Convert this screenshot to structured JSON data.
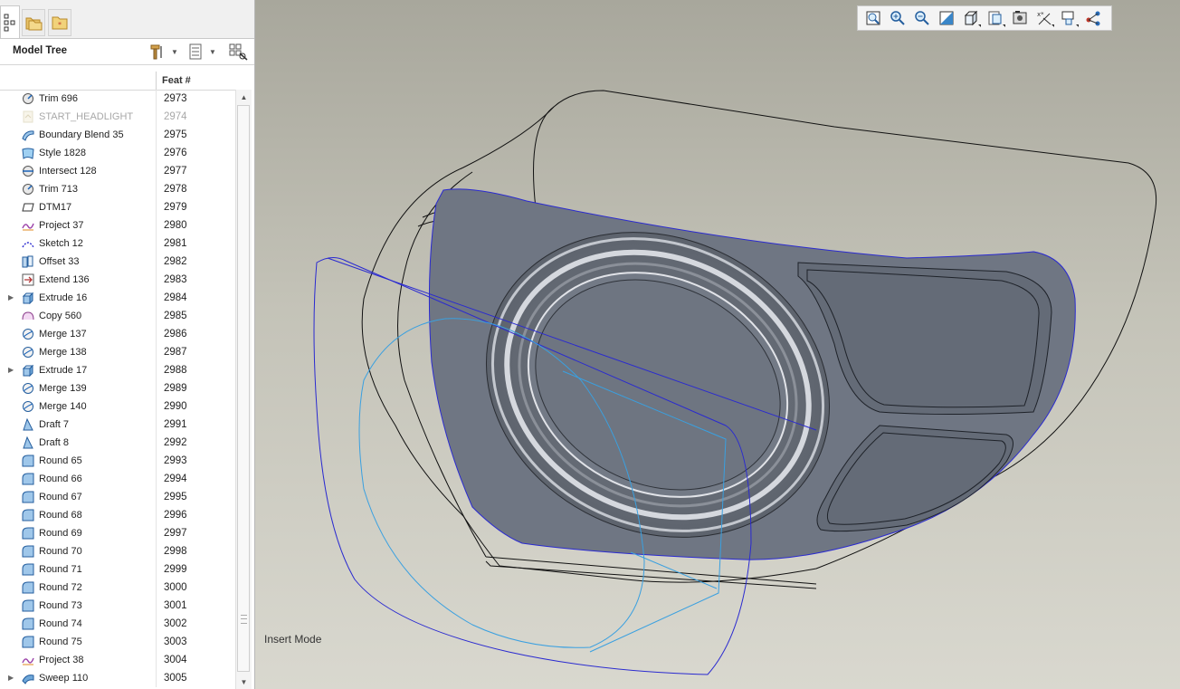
{
  "left_panel": {
    "tabs": [
      {
        "name": "Model Tree",
        "icon": "model-tree-icon"
      },
      {
        "name": "Folder Browser",
        "icon": "folder-browser-icon"
      },
      {
        "name": "Favorites",
        "icon": "favorites-icon"
      }
    ],
    "tree_title": "Model Tree",
    "columns": {
      "feat_num": "Feat #"
    },
    "scroll_position": 0.95,
    "items": [
      {
        "name": "Trim 696",
        "num": "2973",
        "icon": "trim-icon",
        "expandable": false,
        "suppressed": false
      },
      {
        "name": "START_HEADLIGHT",
        "num": "2974",
        "icon": "insert-here-icon",
        "expandable": false,
        "suppressed": true
      },
      {
        "name": "Boundary Blend 35",
        "num": "2975",
        "icon": "boundary-blend-icon",
        "expandable": false,
        "suppressed": false
      },
      {
        "name": "Style 1828",
        "num": "2976",
        "icon": "style-icon",
        "expandable": false,
        "suppressed": false
      },
      {
        "name": "Intersect 128",
        "num": "2977",
        "icon": "intersect-icon",
        "expandable": false,
        "suppressed": false
      },
      {
        "name": "Trim 713",
        "num": "2978",
        "icon": "trim-icon",
        "expandable": false,
        "suppressed": false
      },
      {
        "name": "DTM17",
        "num": "2979",
        "icon": "datum-plane-icon",
        "expandable": false,
        "suppressed": false
      },
      {
        "name": "Project 37",
        "num": "2980",
        "icon": "project-icon",
        "expandable": false,
        "suppressed": false
      },
      {
        "name": "Sketch 12",
        "num": "2981",
        "icon": "sketch-icon",
        "expandable": false,
        "suppressed": false
      },
      {
        "name": "Offset 33",
        "num": "2982",
        "icon": "offset-icon",
        "expandable": false,
        "suppressed": false
      },
      {
        "name": "Extend 136",
        "num": "2983",
        "icon": "extend-icon",
        "expandable": false,
        "suppressed": false
      },
      {
        "name": "Extrude 16",
        "num": "2984",
        "icon": "extrude-icon",
        "expandable": true,
        "suppressed": false
      },
      {
        "name": "Copy 560",
        "num": "2985",
        "icon": "copy-icon",
        "expandable": false,
        "suppressed": false
      },
      {
        "name": "Merge 137",
        "num": "2986",
        "icon": "merge-icon",
        "expandable": false,
        "suppressed": false
      },
      {
        "name": "Merge 138",
        "num": "2987",
        "icon": "merge-icon",
        "expandable": false,
        "suppressed": false
      },
      {
        "name": "Extrude 17",
        "num": "2988",
        "icon": "extrude-icon",
        "expandable": true,
        "suppressed": false
      },
      {
        "name": "Merge 139",
        "num": "2989",
        "icon": "merge-icon",
        "expandable": false,
        "suppressed": false
      },
      {
        "name": "Merge 140",
        "num": "2990",
        "icon": "merge-icon",
        "expandable": false,
        "suppressed": false
      },
      {
        "name": "Draft 7",
        "num": "2991",
        "icon": "draft-icon",
        "expandable": false,
        "suppressed": false
      },
      {
        "name": "Draft 8",
        "num": "2992",
        "icon": "draft-icon",
        "expandable": false,
        "suppressed": false
      },
      {
        "name": "Round 65",
        "num": "2993",
        "icon": "round-icon",
        "expandable": false,
        "suppressed": false
      },
      {
        "name": "Round 66",
        "num": "2994",
        "icon": "round-icon",
        "expandable": false,
        "suppressed": false
      },
      {
        "name": "Round 67",
        "num": "2995",
        "icon": "round-icon",
        "expandable": false,
        "suppressed": false
      },
      {
        "name": "Round 68",
        "num": "2996",
        "icon": "round-icon",
        "expandable": false,
        "suppressed": false
      },
      {
        "name": "Round 69",
        "num": "2997",
        "icon": "round-icon",
        "expandable": false,
        "suppressed": false
      },
      {
        "name": "Round 70",
        "num": "2998",
        "icon": "round-icon",
        "expandable": false,
        "suppressed": false
      },
      {
        "name": "Round 71",
        "num": "2999",
        "icon": "round-icon",
        "expandable": false,
        "suppressed": false
      },
      {
        "name": "Round 72",
        "num": "3000",
        "icon": "round-icon",
        "expandable": false,
        "suppressed": false
      },
      {
        "name": "Round 73",
        "num": "3001",
        "icon": "round-icon",
        "expandable": false,
        "suppressed": false
      },
      {
        "name": "Round 74",
        "num": "3002",
        "icon": "round-icon",
        "expandable": false,
        "suppressed": false
      },
      {
        "name": "Round 75",
        "num": "3003",
        "icon": "round-icon",
        "expandable": false,
        "suppressed": false
      },
      {
        "name": "Project 38",
        "num": "3004",
        "icon": "project-icon",
        "expandable": false,
        "suppressed": false
      },
      {
        "name": "Sweep 110",
        "num": "3005",
        "icon": "sweep-icon",
        "expandable": true,
        "suppressed": false
      }
    ]
  },
  "viewport": {
    "status": "Insert Mode",
    "toolbar": [
      {
        "name": "refit",
        "icon": "refit-icon"
      },
      {
        "name": "zoom-in",
        "icon": "zoom-in-icon"
      },
      {
        "name": "zoom-out",
        "icon": "zoom-out-icon"
      },
      {
        "name": "repaint",
        "icon": "repaint-icon"
      },
      {
        "name": "display-style",
        "icon": "display-style-icon"
      },
      {
        "name": "saved-orientations",
        "icon": "saved-orientations-icon"
      },
      {
        "name": "view-manager",
        "icon": "view-manager-icon"
      },
      {
        "name": "datum-display",
        "icon": "datum-display-icon"
      },
      {
        "name": "annotation-display",
        "icon": "annotation-display-icon"
      },
      {
        "name": "spin-center",
        "icon": "spin-center-icon"
      }
    ]
  },
  "colors": {
    "surface_fill": "#6f7683",
    "selected_edge": "#2a2ad0",
    "sketch_curve": "#3aa0e0",
    "wire_edge": "#111111"
  }
}
